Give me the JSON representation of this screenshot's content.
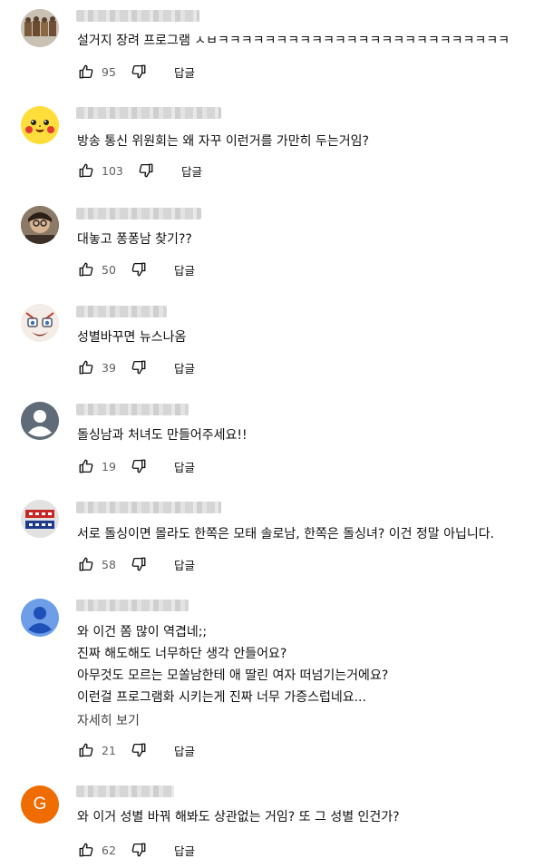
{
  "comments": [
    {
      "text_lines": [
        "설거지 장려 프로그램 ㅅㅂㅋㅋㅋㅋㅋㅋㅋㅋㅋㅋㅋㅋㅋㅋㅋㅋㅋㅋㅋㅋㅋㅋㅋㅋㅋ"
      ],
      "likes": "95",
      "reply": "답글",
      "avatar": "photo-avatar"
    },
    {
      "text_lines": [
        "방송 통신 위원회는 왜 자꾸 이런거를 가만히 두는거임?"
      ],
      "likes": "103",
      "reply": "답글",
      "avatar": "pikachu-avatar"
    },
    {
      "text_lines": [
        "대놓고 퐁퐁남 찾기??"
      ],
      "likes": "50",
      "reply": "답글",
      "avatar": "photo-avatar"
    },
    {
      "text_lines": [
        "성별바꾸면 뉴스나옴"
      ],
      "likes": "39",
      "reply": "답글",
      "avatar": "anime-avatar"
    },
    {
      "text_lines": [
        "돌싱남과 처녀도 만들어주세요!!"
      ],
      "likes": "19",
      "reply": "답글",
      "avatar": "default-avatar"
    },
    {
      "text_lines": [
        "서로 돌싱이면 몰라도 한쪽은 모태 솔로남, 한쪽은 돌싱녀? 이건 정말 아닙니다."
      ],
      "likes": "58",
      "reply": "답글",
      "avatar": "badge-avatar"
    },
    {
      "text_lines": [
        "와 이건 쫌 많이 역겹네;;",
        "진짜 해도해도 너무하단 생각 안들어요?",
        "아무것도 모르는 모쏠남한테 애 딸린 여자 떠넘기는거에요?",
        "이런걸 프로그램화 시키는게 진짜 너무 가증스럽네요..."
      ],
      "more": "자세히 보기",
      "likes": "21",
      "reply": "답글",
      "avatar": "blue-user-avatar"
    },
    {
      "text_lines": [
        "와 이거 성별 바꿔 해봐도 상관없는 거임? 또 그 성별 인건가?"
      ],
      "likes": "62",
      "reply": "답글",
      "avatar": "letter-avatar",
      "avatar_letter": "G"
    }
  ],
  "colors": {
    "text": "#0f0f0f",
    "secondary": "#606060",
    "letter_avatar_bg": "#ef6c00",
    "blue_avatar_bg": "#6e9ee8"
  }
}
